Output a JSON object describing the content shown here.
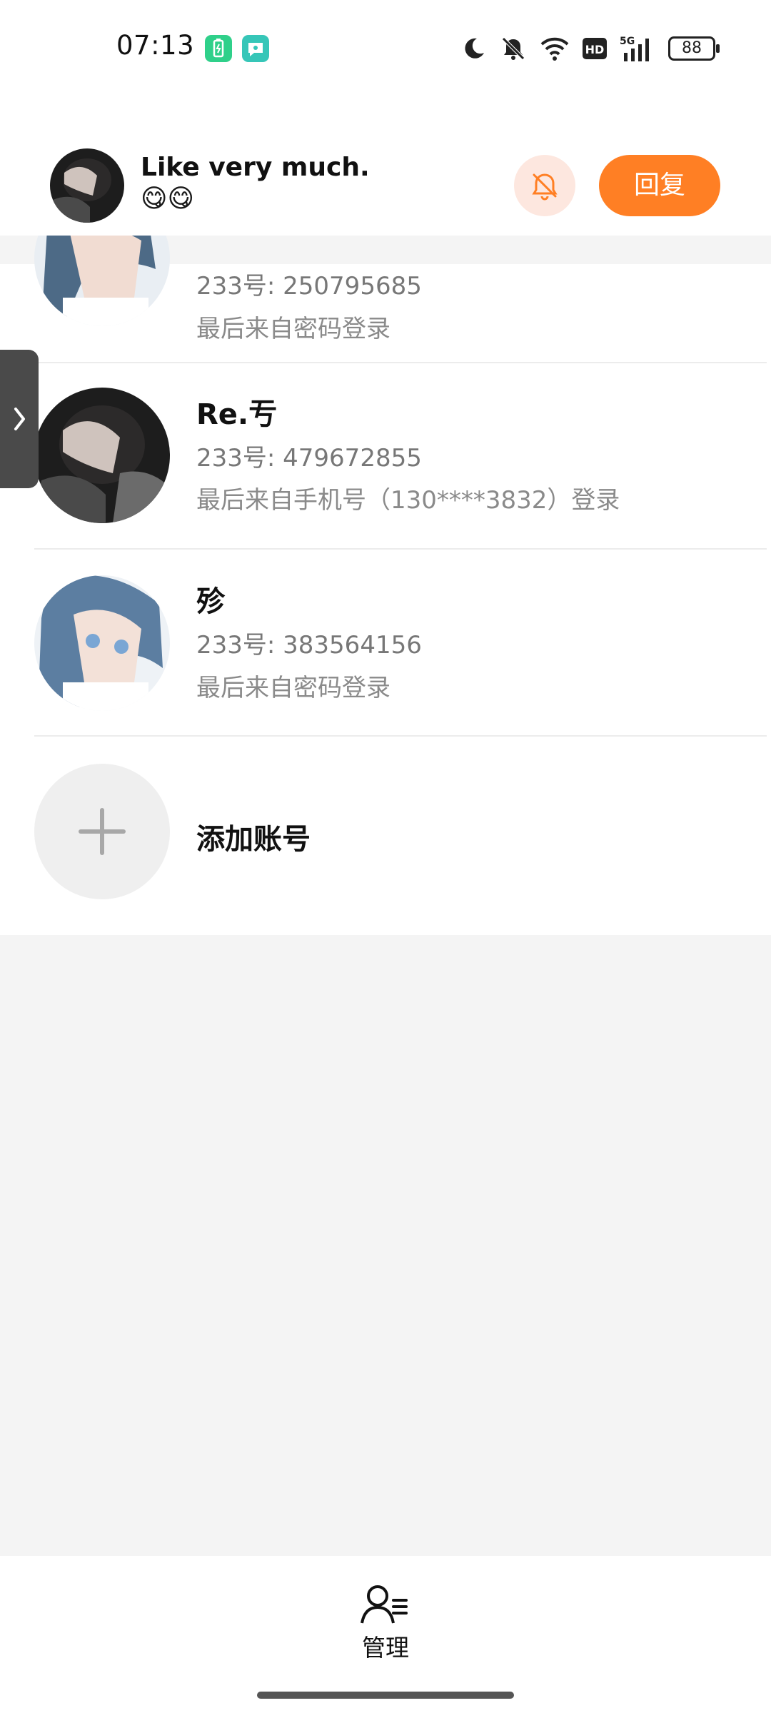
{
  "status_bar": {
    "time": "07:13",
    "battery": "88",
    "icons": [
      "green-battery-app-icon",
      "teal-chat-app-icon",
      "moon-icon",
      "bell-off-icon",
      "wifi-icon",
      "hd-icon",
      "signal-5g-icon",
      "battery-icon"
    ]
  },
  "notification": {
    "sender": "Like very much.",
    "message": "😋😋",
    "mute_icon": "bell-off-icon",
    "reply_label": "回复",
    "accent": "#ff7f24"
  },
  "accounts": [
    {
      "name": "",
      "uid": "233号: 250795685",
      "last_login": "最后来自密码登录",
      "avatar": "anime-avatar"
    },
    {
      "name": "Re.亐",
      "uid": "233号: 479672855",
      "last_login": "最后来自手机号（130****3832）登录",
      "avatar": "photo-avatar"
    },
    {
      "name": "殄",
      "uid": "233号: 383564156",
      "last_login": "最后来自密码登录",
      "avatar": "anime-avatar"
    }
  ],
  "add_account": {
    "label": "添加账号",
    "icon": "plus-icon"
  },
  "side_tab": {
    "icon": "chevron-right-icon"
  },
  "bottom_nav": {
    "label": "管理",
    "icon": "user-manage-icon"
  }
}
